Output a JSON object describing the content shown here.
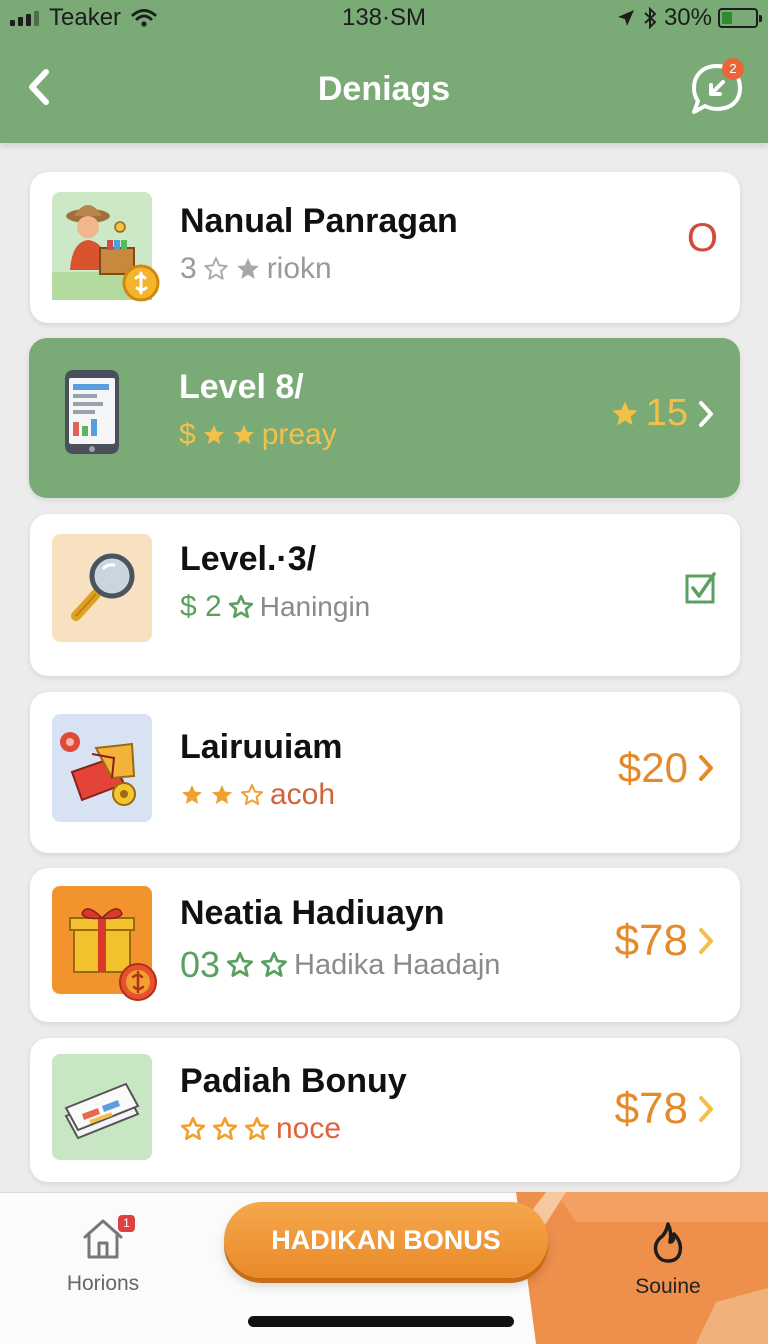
{
  "status_bar": {
    "carrier": "Teaker",
    "time": "138·SM",
    "battery": "30%",
    "battery_level": 0.3,
    "icons": [
      "signal-icon",
      "wifi-icon",
      "location-arrow-icon",
      "bluetooth-icon",
      "battery-icon"
    ]
  },
  "header": {
    "title": "Deniags",
    "back_icon": "chevron-left-icon",
    "chat_icon": "chat-bubble-icon",
    "chat_badge": "2"
  },
  "colors": {
    "header_green": "#7aab76",
    "star_orange": "#f0a030",
    "price_orange": "#e58a2a",
    "green_text": "#5aa060",
    "red_text": "#d24b3a",
    "muted_gray": "#9a9a9a"
  },
  "rows": [
    {
      "name": "Nanual Panragan",
      "prefix": "3",
      "rating": 2,
      "rating_max": 2,
      "note": "riokn",
      "value": "O",
      "active": false,
      "icon": "farmer-icon"
    },
    {
      "name": "Level 8/",
      "prefix": "$",
      "rating": 2,
      "rating_max": 2,
      "note": "preay",
      "value": "15",
      "active": true,
      "icon": "phone-icon"
    },
    {
      "name": "Level.·3/",
      "prefix": "$ 2",
      "rating": 1,
      "rating_max": 1,
      "note": "Haningin",
      "value": "",
      "active": false,
      "icon": "magnifier-icon"
    },
    {
      "name": "Lairuuiam",
      "prefix": "",
      "rating": 2,
      "rating_max": 3,
      "note": "acoh",
      "value": "$20",
      "active": false,
      "icon": "gift-box-icon"
    },
    {
      "name": "Neatia Hadiuayn",
      "prefix": "03",
      "rating": 2,
      "rating_max": 2,
      "note": "Hadika Haadajn",
      "value": "$78",
      "active": false,
      "icon": "present-icon"
    },
    {
      "name": "Padiah Bonuy",
      "prefix": "",
      "rating": 0,
      "rating_max": 3,
      "note": "noce",
      "value": "$78",
      "active": false,
      "icon": "ticket-stack-icon"
    }
  ],
  "bottom_nav": {
    "home_label": "Horions",
    "home_badge": "1",
    "bonus_label": "HADIKAN BONUS",
    "right_label": "Souine"
  }
}
